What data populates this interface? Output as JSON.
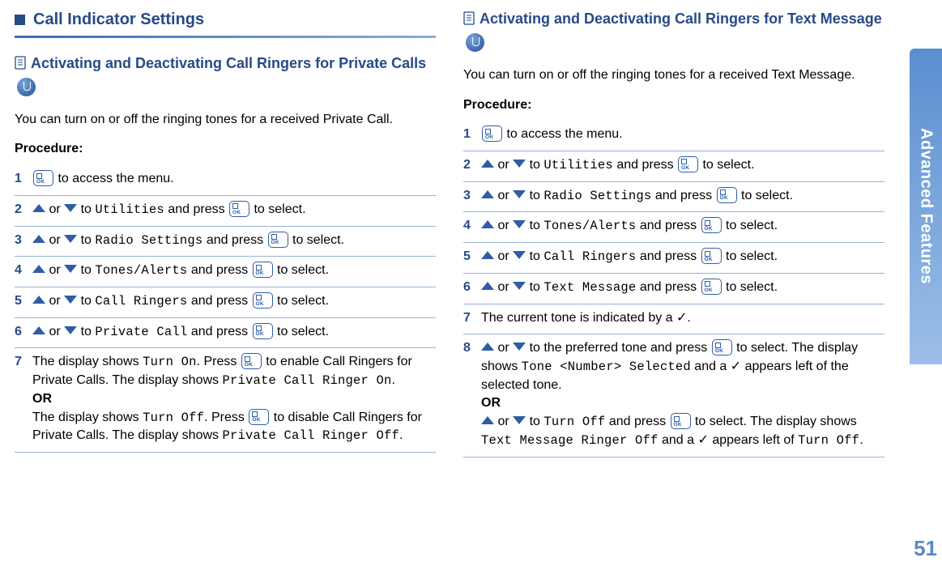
{
  "sideTab": "Advanced Features",
  "pageNumber": "51",
  "left": {
    "sectionTitle": "Call Indicator Settings",
    "subTitle": "Activating and Deactivating Call Ringers for Private Calls",
    "intro": "You can turn on or off the ringing tones for a received Private Call.",
    "procLabel": "Procedure:",
    "steps": {
      "s1": {
        "num": "1",
        "tail": " to access the menu."
      },
      "s2": {
        "num": "2",
        "mid1": " or ",
        "mid2": " to ",
        "menu": "Utilities",
        "mid3": " and press ",
        "tail": " to select."
      },
      "s3": {
        "num": "3",
        "mid1": " or ",
        "mid2": " to ",
        "menu": "Radio Settings",
        "mid3": " and press ",
        "tail": " to select."
      },
      "s4": {
        "num": "4",
        "mid1": " or ",
        "mid2": " to ",
        "menu": "Tones/Alerts",
        "mid3": " and press ",
        "tail": " to select."
      },
      "s5": {
        "num": "5",
        "mid1": " or ",
        "mid2": " to ",
        "menu": "Call Ringers",
        "mid3": " and press ",
        "tail": " to select."
      },
      "s6": {
        "num": "6",
        "mid1": " or ",
        "mid2": " to ",
        "menu": "Private Call",
        "mid3": " and press ",
        "tail": " to select."
      },
      "s7": {
        "num": "7",
        "a1": "The display shows ",
        "turnOn": "Turn On",
        "a2": ". Press ",
        "a3": " to enable Call Ringers for Private Calls. The display shows ",
        "pRingerOn": "Private Call Ringer On",
        "a4": ".",
        "or": "OR",
        "b1": "The display shows ",
        "turnOff": "Turn Off",
        "b2": ". Press ",
        "b3": " to disable Call Ringers for Private Calls. The display shows ",
        "pRingerOff": "Private Call Ringer Off",
        "b4": "."
      }
    }
  },
  "right": {
    "subTitle": "Activating and Deactivating Call Ringers for Text Message",
    "intro": "You can turn on or off the ringing tones for a received Text Message.",
    "procLabel": "Procedure:",
    "steps": {
      "s1": {
        "num": "1",
        "tail": " to access the menu."
      },
      "s2": {
        "num": "2",
        "mid1": " or ",
        "mid2": " to ",
        "menu": "Utilities",
        "mid3": " and press ",
        "tail": " to select."
      },
      "s3": {
        "num": "3",
        "mid1": " or ",
        "mid2": " to ",
        "menu": "Radio Settings",
        "mid3": " and press ",
        "tail": " to select."
      },
      "s4": {
        "num": "4",
        "mid1": " or ",
        "mid2": " to ",
        "menu": "Tones/Alerts",
        "mid3": " and press ",
        "tail": " to select."
      },
      "s5": {
        "num": "5",
        "mid1": " or ",
        "mid2": " to ",
        "menu": "Call Ringers",
        "mid3": " and press ",
        "tail": " to select."
      },
      "s6": {
        "num": "6",
        "mid1": " or ",
        "mid2": " to ",
        "menu": "Text Message",
        "mid3": " and press ",
        "tail": " to select."
      },
      "s7": {
        "num": "7",
        "text": "The current tone is indicated by a ✓."
      },
      "s8": {
        "num": "8",
        "a_mid1": " or ",
        "a_mid2": " to the preferred tone and press ",
        "a_tail1": " to select. The display shows ",
        "toneSel": "Tone <Number> Selected",
        "a_tail2": " and a ✓ appears left of the selected tone.",
        "or": "OR",
        "b_mid1": " or ",
        "b_mid2": " to ",
        "turnOff": "Turn Off",
        "b_mid3": " and press ",
        "b_tail1": " to select. The display shows ",
        "ringerOff": "Text Message Ringer Off",
        "b_tail2": " and a ✓ appears left of ",
        "turnOff2": "Turn Off",
        "b_tail3": "."
      }
    }
  }
}
